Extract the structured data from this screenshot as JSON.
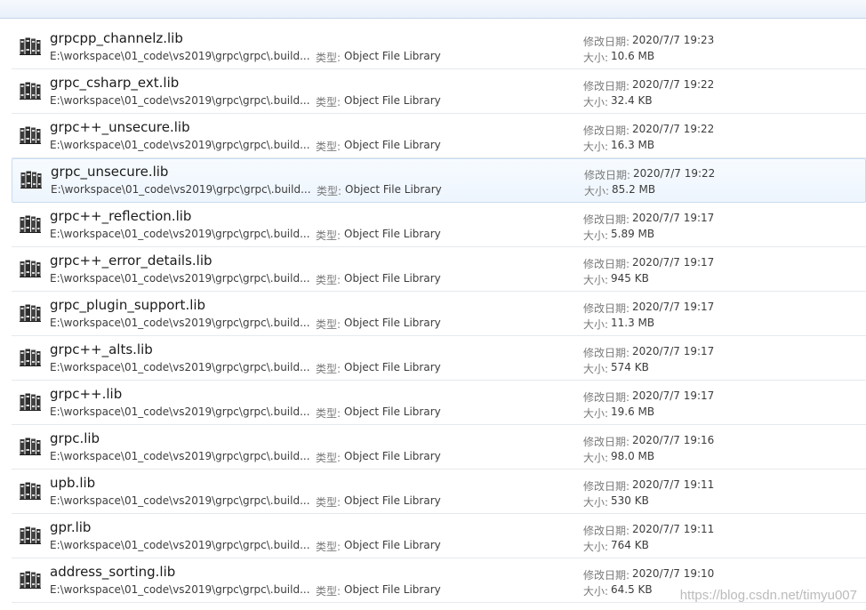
{
  "labels": {
    "type": "类型:",
    "modified": "修改日期:",
    "size": "大小:"
  },
  "icon": "library-books-icon",
  "files": [
    {
      "name": "grpcpp_channelz.lib",
      "path": "E:\\workspace\\01_code\\vs2019\\grpc\\grpc\\.build...",
      "type": "Object File Library",
      "modified": "2020/7/7 19:23",
      "size": "10.6 MB"
    },
    {
      "name": "grpc_csharp_ext.lib",
      "path": "E:\\workspace\\01_code\\vs2019\\grpc\\grpc\\.build...",
      "type": "Object File Library",
      "modified": "2020/7/7 19:22",
      "size": "32.4 KB"
    },
    {
      "name": "grpc++_unsecure.lib",
      "path": "E:\\workspace\\01_code\\vs2019\\grpc\\grpc\\.build...",
      "type": "Object File Library",
      "modified": "2020/7/7 19:22",
      "size": "16.3 MB"
    },
    {
      "name": "grpc_unsecure.lib",
      "path": "E:\\workspace\\01_code\\vs2019\\grpc\\grpc\\.build...",
      "type": "Object File Library",
      "modified": "2020/7/7 19:22",
      "size": "85.2 MB"
    },
    {
      "name": "grpc++_reflection.lib",
      "path": "E:\\workspace\\01_code\\vs2019\\grpc\\grpc\\.build...",
      "type": "Object File Library",
      "modified": "2020/7/7 19:17",
      "size": "5.89 MB"
    },
    {
      "name": "grpc++_error_details.lib",
      "path": "E:\\workspace\\01_code\\vs2019\\grpc\\grpc\\.build...",
      "type": "Object File Library",
      "modified": "2020/7/7 19:17",
      "size": "945 KB"
    },
    {
      "name": "grpc_plugin_support.lib",
      "path": "E:\\workspace\\01_code\\vs2019\\grpc\\grpc\\.build...",
      "type": "Object File Library",
      "modified": "2020/7/7 19:17",
      "size": "11.3 MB"
    },
    {
      "name": "grpc++_alts.lib",
      "path": "E:\\workspace\\01_code\\vs2019\\grpc\\grpc\\.build...",
      "type": "Object File Library",
      "modified": "2020/7/7 19:17",
      "size": "574 KB"
    },
    {
      "name": "grpc++.lib",
      "path": "E:\\workspace\\01_code\\vs2019\\grpc\\grpc\\.build...",
      "type": "Object File Library",
      "modified": "2020/7/7 19:17",
      "size": "19.6 MB"
    },
    {
      "name": "grpc.lib",
      "path": "E:\\workspace\\01_code\\vs2019\\grpc\\grpc\\.build...",
      "type": "Object File Library",
      "modified": "2020/7/7 19:16",
      "size": "98.0 MB"
    },
    {
      "name": "upb.lib",
      "path": "E:\\workspace\\01_code\\vs2019\\grpc\\grpc\\.build...",
      "type": "Object File Library",
      "modified": "2020/7/7 19:11",
      "size": "530 KB"
    },
    {
      "name": "gpr.lib",
      "path": "E:\\workspace\\01_code\\vs2019\\grpc\\grpc\\.build...",
      "type": "Object File Library",
      "modified": "2020/7/7 19:11",
      "size": "764 KB"
    },
    {
      "name": "address_sorting.lib",
      "path": "E:\\workspace\\01_code\\vs2019\\grpc\\grpc\\.build...",
      "type": "Object File Library",
      "modified": "2020/7/7 19:10",
      "size": "64.5 KB"
    }
  ],
  "selected_index": 3,
  "watermark": "https://blog.csdn.net/timyu007"
}
